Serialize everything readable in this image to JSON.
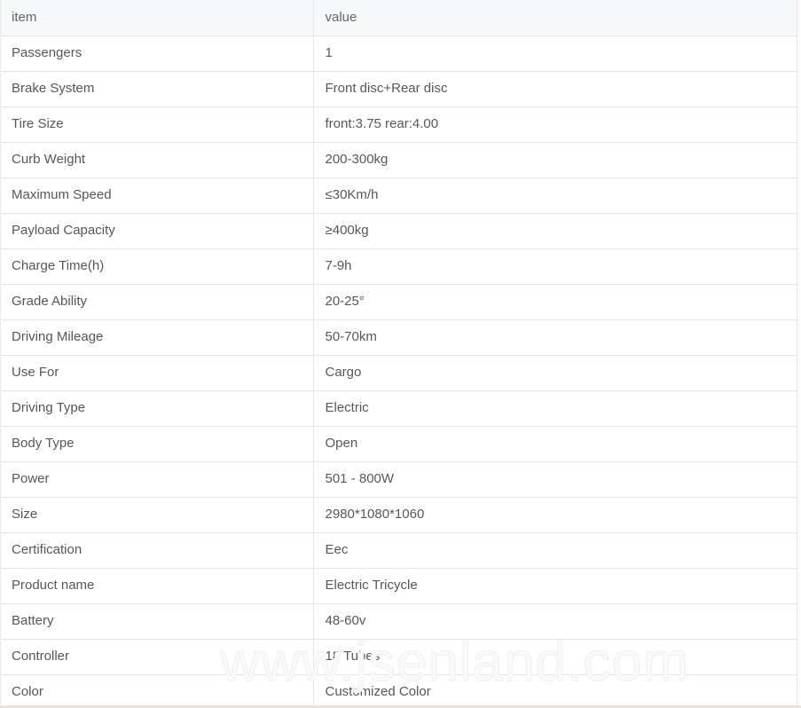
{
  "table": {
    "headers": {
      "item": "item",
      "value": "value"
    },
    "rows": [
      {
        "item": "Passengers",
        "value": "1"
      },
      {
        "item": "Brake System",
        "value": "Front disc+Rear disc"
      },
      {
        "item": "Tire Size",
        "value": "front:3.75 rear:4.00"
      },
      {
        "item": "Curb Weight",
        "value": "200-300kg"
      },
      {
        "item": "Maximum Speed",
        "value": "≤30Km/h"
      },
      {
        "item": "Payload Capacity",
        "value": "≥400kg"
      },
      {
        "item": "Charge Time(h)",
        "value": "7-9h"
      },
      {
        "item": "Grade Ability",
        "value": "20-25°"
      },
      {
        "item": "Driving Mileage",
        "value": "50-70km"
      },
      {
        "item": "Use For",
        "value": "Cargo"
      },
      {
        "item": "Driving Type",
        "value": "Electric"
      },
      {
        "item": "Body Type",
        "value": "Open"
      },
      {
        "item": "Power",
        "value": "501 - 800W"
      },
      {
        "item": "Size",
        "value": "2980*1080*1060"
      },
      {
        "item": "Certification",
        "value": "Eec"
      },
      {
        "item": "Product name",
        "value": "Electric Tricycle"
      },
      {
        "item": "Battery",
        "value": "48-60v"
      },
      {
        "item": "Controller",
        "value": "18 Tubes"
      },
      {
        "item": "Color",
        "value": "Customized Color"
      }
    ]
  },
  "watermark": {
    "text": "www.jsenland.com"
  },
  "colors": {
    "header_background": "#f7f8fa",
    "border": "#e3e5e8",
    "text": "#54585c",
    "bottom_rule": "#f3dede",
    "watermark": "#f1f1f1"
  }
}
